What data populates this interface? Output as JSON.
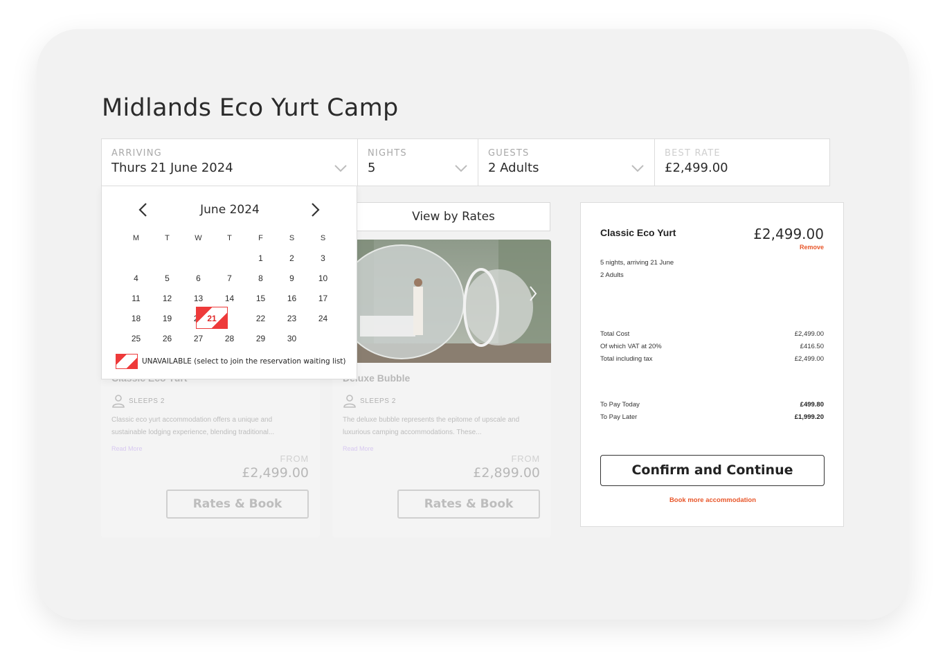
{
  "page": {
    "title": "Midlands Eco Yurt Camp"
  },
  "search": {
    "arriving": {
      "label": "ARRIVING",
      "value": "Thurs 21 June 2024"
    },
    "nights": {
      "label": "NIGHTS",
      "value": "5"
    },
    "guests": {
      "label": "GUESTS",
      "value": "2 Adults"
    },
    "best_rate": {
      "label": "BEST RATE",
      "value": "£2,499.00"
    }
  },
  "calendar": {
    "month": "June 2024",
    "weekdays": [
      "M",
      "T",
      "W",
      "T",
      "F",
      "S",
      "S"
    ],
    "weeks": [
      [
        "",
        "",
        "",
        "",
        "1",
        "2",
        "3"
      ],
      [
        "4",
        "5",
        "6",
        "7",
        "8",
        "9",
        "10"
      ],
      [
        "11",
        "12",
        "13",
        "14",
        "15",
        "16",
        "17"
      ],
      [
        "18",
        "19",
        "20",
        "",
        "22",
        "23",
        "24"
      ],
      [
        "25",
        "26",
        "27",
        "28",
        "29",
        "30",
        ""
      ]
    ],
    "selected_unavailable": "21",
    "legend": "UNAVAILABLE (select to join the reservation waiting list)",
    "accent": "#ee3a3a"
  },
  "view_rates": {
    "label": "View by Rates"
  },
  "cards": [
    {
      "title": "Classic Eco Yurt",
      "sleeps": "SLEEPS 2",
      "description": "Classic eco yurt accommodation offers a unique and sustainable lodging experience, blending traditional...",
      "read_more": "Read More",
      "from": "FROM",
      "price": "£2,499.00",
      "button": "Rates & Book"
    },
    {
      "title": "Deluxe Bubble",
      "sleeps": "SLEEPS 2",
      "description": "The deluxe bubble represents the epitome of upscale and luxurious camping accommodations. These...",
      "read_more": "Read More",
      "from": "FROM",
      "price": "£2,899.00",
      "button": "Rates & Book"
    }
  ],
  "summary": {
    "name": "Classic Eco Yurt",
    "price": "£2,499.00",
    "remove": "Remove",
    "details": [
      "5 nights, arriving 21 June",
      "2 Adults"
    ],
    "costs": [
      {
        "label": "Total Cost",
        "value": "£2,499.00"
      },
      {
        "label": "Of which VAT at 20%",
        "value": "£416.50"
      },
      {
        "label": "Total including tax",
        "value": "£2,499.00"
      }
    ],
    "payments": [
      {
        "label": "To Pay Today",
        "value": "£499.80"
      },
      {
        "label": "To Pay Later",
        "value": "£1,999.20"
      }
    ],
    "confirm": "Confirm and Continue",
    "book_more": "Book more accommodation",
    "accent": "#e8562a"
  }
}
